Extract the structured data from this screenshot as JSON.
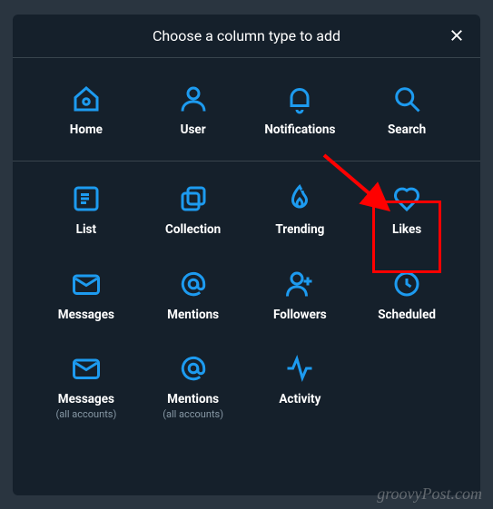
{
  "header": {
    "title": "Choose a column type to add"
  },
  "items": {
    "home": {
      "label": "Home"
    },
    "user": {
      "label": "User"
    },
    "notifications": {
      "label": "Notifications"
    },
    "search": {
      "label": "Search"
    },
    "list": {
      "label": "List"
    },
    "collection": {
      "label": "Collection"
    },
    "trending": {
      "label": "Trending"
    },
    "likes": {
      "label": "Likes"
    },
    "messages": {
      "label": "Messages"
    },
    "mentions": {
      "label": "Mentions"
    },
    "followers": {
      "label": "Followers"
    },
    "scheduled": {
      "label": "Scheduled"
    },
    "messages_all": {
      "label": "Messages",
      "sublabel": "(all accounts)"
    },
    "mentions_all": {
      "label": "Mentions",
      "sublabel": "(all accounts)"
    },
    "activity": {
      "label": "Activity"
    }
  },
  "annotation": {
    "highlight_target": "likes",
    "accent_color": "#ff0000"
  },
  "watermark": "groovyPost.com"
}
